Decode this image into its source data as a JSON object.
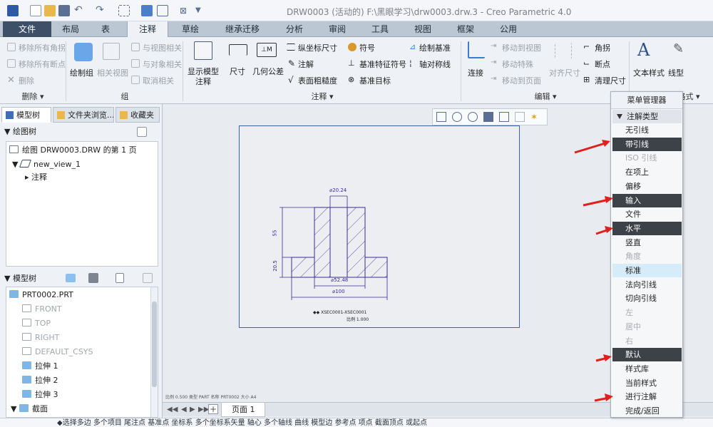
{
  "window": {
    "title": "DRW0003 (活动的) F:\\黑眼学习\\drw0003.drw.3 - Creo Parametric 4.0"
  },
  "tabs": [
    "文件",
    "布局",
    "表",
    "注释",
    "草绘",
    "继承迁移",
    "分析",
    "审阅",
    "工具",
    "视图",
    "框架",
    "公用"
  ],
  "ribbon": {
    "delete_group": {
      "items": [
        "移除所有角拐",
        "移除所有断点",
        "删除"
      ],
      "label": "删除 ▾"
    },
    "group_group": {
      "items": [
        "绘制组",
        "相关视图",
        "与视图相关",
        "与对象相关",
        "取消相关"
      ],
      "label": "组"
    },
    "annotate_group": {
      "items": [
        "显示模型",
        "注释",
        "尺寸",
        "几何公差",
        "纵坐标尺寸",
        "注解",
        "表面粗糙度",
        "符号",
        "基准特征符号",
        "基准目标",
        "绘制基准",
        "轴对称线"
      ],
      "label": "注释 ▾"
    },
    "edit_group": {
      "items": [
        "连接",
        "移动到视图",
        "移动特殊",
        "移动到页面",
        "对齐尺寸",
        "角拐",
        "断点",
        "清理尺寸"
      ],
      "label": "编辑 ▾"
    },
    "format_group": {
      "items": [
        "文本样式",
        "线型"
      ],
      "label": "格式 ▾"
    }
  },
  "left_panel": {
    "tabs": [
      "模型树",
      "文件夹浏览...",
      "收藏夹"
    ],
    "drawing_tree": {
      "header": "绘图树",
      "items": [
        "绘图 DRW0003.DRW 的第 1 页",
        "new_view_1",
        "注释"
      ]
    },
    "model_tree": {
      "header": "模型树",
      "items": [
        "PRT0002.PRT",
        "FRONT",
        "TOP",
        "RIGHT",
        "DEFAULT_CSYS",
        "拉伸 1",
        "拉伸 2",
        "拉伸 3",
        "截面"
      ]
    }
  },
  "drawing": {
    "dim_top": "⌀20.24",
    "dim_mid": "⌀52.48",
    "dim_bottom": "⌀100",
    "dim_height": "55",
    "dim_flange": "20.5",
    "section_label": "XSEC0001-XSEC0001",
    "scale_label": "比例 1.000",
    "status_line": "比例 0.500  类型 PART  名称 PRT0002  大小 A4"
  },
  "page_bar": {
    "page_tab": "页面 1"
  },
  "status_bar": {
    "message": "◆选择多边 多个项目 尾注点 基准点 坐标系 多个坐标系矢量 轴心 多个轴线 曲线 模型边 参考点 项点 截面顶点 或起点"
  },
  "menu_manager": {
    "title": "菜单管理器",
    "section": "注解类型",
    "rows": [
      {
        "label": "无引线",
        "state": "normal"
      },
      {
        "label": "带引线",
        "state": "dark"
      },
      {
        "label": "ISO 引线",
        "state": "dim"
      },
      {
        "label": "在项上",
        "state": "normal"
      },
      {
        "label": "偏移",
        "state": "normal"
      },
      {
        "label": "输入",
        "state": "dark"
      },
      {
        "label": "文件",
        "state": "normal"
      },
      {
        "label": "水平",
        "state": "dark"
      },
      {
        "label": "竖直",
        "state": "normal"
      },
      {
        "label": "角度",
        "state": "dim"
      },
      {
        "label": "标准",
        "state": "hl"
      },
      {
        "label": "法向引线",
        "state": "normal"
      },
      {
        "label": "切向引线",
        "state": "normal"
      },
      {
        "label": "左",
        "state": "dim"
      },
      {
        "label": "居中",
        "state": "dim"
      },
      {
        "label": "右",
        "state": "dim"
      },
      {
        "label": "默认",
        "state": "dark"
      },
      {
        "label": "样式库",
        "state": "normal"
      },
      {
        "label": "当前样式",
        "state": "normal"
      },
      {
        "label": "进行注解",
        "state": "normal"
      },
      {
        "label": "完成/返回",
        "state": "normal"
      }
    ]
  },
  "colors": {
    "accent_dark": "#3e4f68",
    "menu_dark": "#3d4148",
    "highlight": "#d6ecf8",
    "drawing_line": "#3a2c8f",
    "arrow": "#e0201a"
  }
}
